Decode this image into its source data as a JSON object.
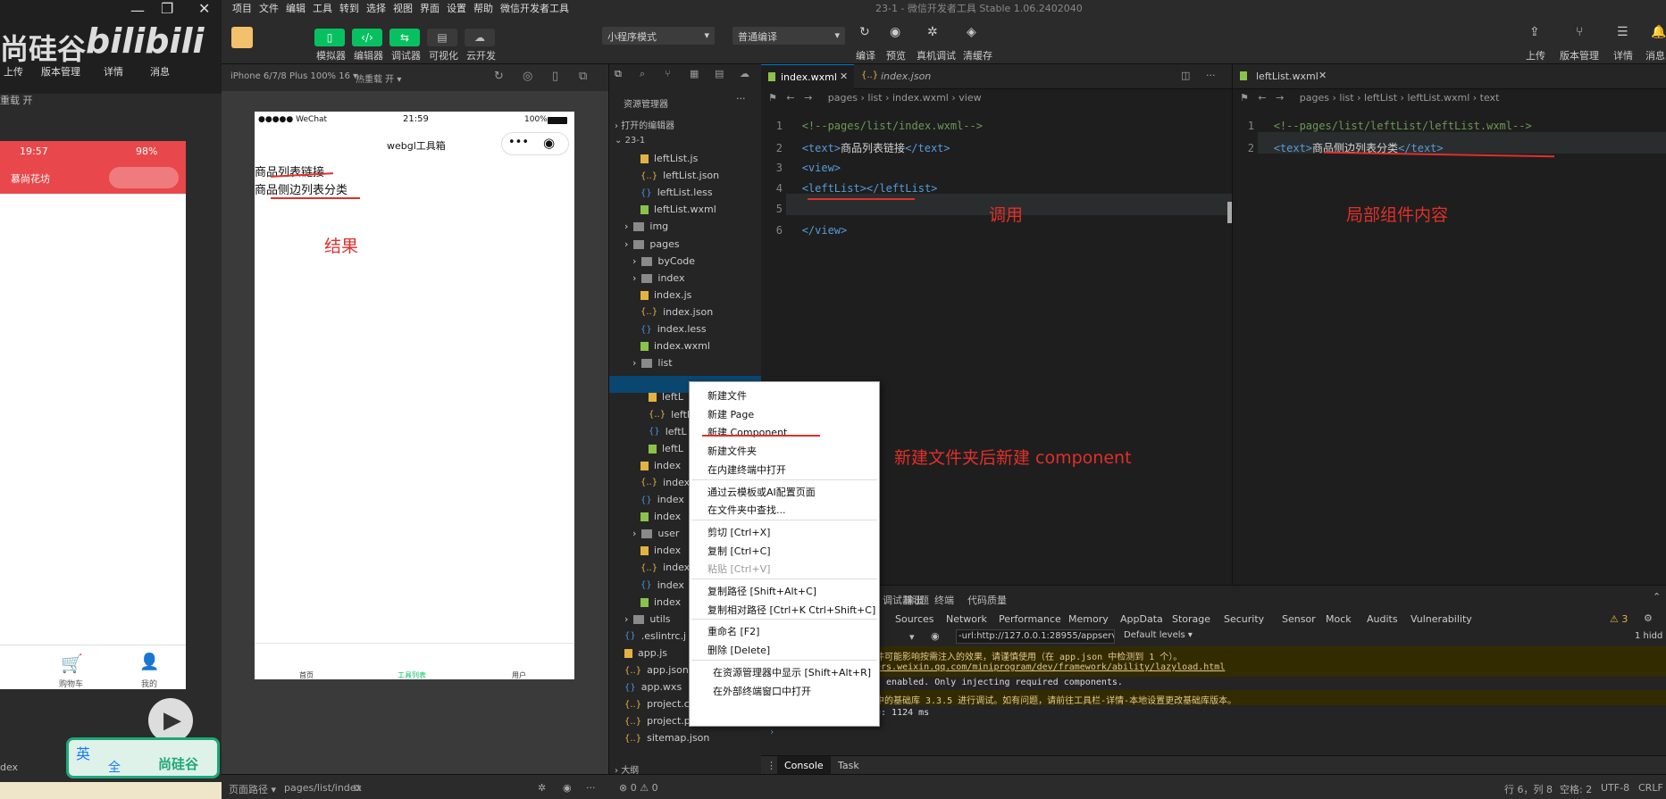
{
  "window_title": "23-1 - 微信开发者工具 Stable 1.06.2402040",
  "menu": [
    "项目",
    "文件",
    "编辑",
    "工具",
    "转到",
    "选择",
    "视图",
    "界面",
    "设置",
    "帮助",
    "微信开发者工具"
  ],
  "toolbar": {
    "buttons": [
      "模拟器",
      "编辑器",
      "调试器",
      "可视化",
      "云开发"
    ],
    "mode_select": "小程序模式",
    "compile_select": "普通编译",
    "actions": [
      "编译",
      "预览",
      "真机调试",
      "清缓存"
    ],
    "right_actions": [
      "上传",
      "版本管理",
      "详情",
      "消息"
    ]
  },
  "simulator": {
    "device": "iPhone 6/7/8 Plus 100% 16",
    "hotreload": "热重载 开",
    "status_carrier": "●●●●● WeChat",
    "status_time": "21:59",
    "status_battery": "100%",
    "nav_title": "webgl工具箱",
    "content_lines": [
      "商品列表链接",
      "商品侧边列表分类"
    ],
    "tabbar": [
      "首页",
      "工具列表",
      "用户"
    ]
  },
  "left_overlay": {
    "brand_text": "尚硅谷",
    "bili_text": "bilibili",
    "menu": [
      "上传",
      "版本管理",
      "详情",
      "消息"
    ],
    "hot": "重载 开",
    "time": "19:57",
    "battery": "98%",
    "shop_title": "慕尚花坊",
    "tabs": [
      "购物车",
      "我的"
    ],
    "ime": "英",
    "ime2": "全",
    "brand_bottom": "尚硅谷",
    "index_label": "dex"
  },
  "explorer": {
    "title": "资源管理器",
    "open_editors": "打开的编辑器",
    "project": "23-1",
    "outline": "大纲",
    "rows": [
      {
        "label": "leftList.js",
        "type": "js",
        "indent": 3
      },
      {
        "label": "leftList.json",
        "type": "json",
        "indent": 3
      },
      {
        "label": "leftList.less",
        "type": "less",
        "indent": 3
      },
      {
        "label": "leftList.wxml",
        "type": "wxml",
        "indent": 3
      },
      {
        "label": "img",
        "type": "folder",
        "indent": 1
      },
      {
        "label": "pages",
        "type": "folder",
        "indent": 1
      },
      {
        "label": "byCode",
        "type": "folder",
        "indent": 2
      },
      {
        "label": "index",
        "type": "folder",
        "indent": 2
      },
      {
        "label": "index.js",
        "type": "js",
        "indent": 3
      },
      {
        "label": "index.json",
        "type": "json",
        "indent": 3
      },
      {
        "label": "index.less",
        "type": "less",
        "indent": 3
      },
      {
        "label": "index.wxml",
        "type": "wxml",
        "indent": 3
      },
      {
        "label": "list",
        "type": "folder",
        "indent": 2
      },
      {
        "label": "leftList",
        "type": "folder",
        "indent": 3
      },
      {
        "label": "leftL",
        "type": "js",
        "indent": 4
      },
      {
        "label": "leftL",
        "type": "json",
        "indent": 4
      },
      {
        "label": "leftL",
        "type": "less",
        "indent": 4
      },
      {
        "label": "leftL",
        "type": "wxml",
        "indent": 4
      },
      {
        "label": "index",
        "type": "js",
        "indent": 3
      },
      {
        "label": "index",
        "type": "json",
        "indent": 3
      },
      {
        "label": "index",
        "type": "less",
        "indent": 3
      },
      {
        "label": "index",
        "type": "wxml",
        "indent": 3
      },
      {
        "label": "user",
        "type": "folder",
        "indent": 2
      },
      {
        "label": "index",
        "type": "js",
        "indent": 3
      },
      {
        "label": "index",
        "type": "json",
        "indent": 3
      },
      {
        "label": "index",
        "type": "less",
        "indent": 3
      },
      {
        "label": "index",
        "type": "wxml",
        "indent": 3
      },
      {
        "label": "utils",
        "type": "folder",
        "indent": 1
      },
      {
        "label": ".eslintrc.j",
        "type": "less",
        "indent": 1
      },
      {
        "label": "app.js",
        "type": "js",
        "indent": 1
      },
      {
        "label": "app.json",
        "type": "json",
        "indent": 1
      },
      {
        "label": "app.wxs",
        "type": "less",
        "indent": 1
      },
      {
        "label": "project.c",
        "type": "json",
        "indent": 1
      },
      {
        "label": "project.p",
        "type": "json",
        "indent": 1
      },
      {
        "label": "sitemap.json",
        "type": "json",
        "indent": 1
      }
    ]
  },
  "editor1": {
    "tabs": [
      "index.wxml",
      "index.json"
    ],
    "breadcrumb": [
      "pages",
      "list",
      "index.wxml",
      "view"
    ],
    "lines": [
      {
        "n": "1",
        "parts": [
          {
            "c": "cm",
            "t": "<!--pages/list/index.wxml-->"
          }
        ]
      },
      {
        "n": "2",
        "parts": [
          {
            "c": "tg",
            "t": "<text>"
          },
          {
            "c": "tx",
            "t": "商品列表链接"
          },
          {
            "c": "tg",
            "t": "</text>"
          }
        ]
      },
      {
        "n": "3",
        "parts": [
          {
            "c": "tg",
            "t": "<view>"
          }
        ]
      },
      {
        "n": "4",
        "parts": [
          {
            "c": "tg",
            "t": "<leftList></leftList>"
          }
        ]
      },
      {
        "n": "5",
        "parts": []
      },
      {
        "n": "6",
        "parts": [
          {
            "c": "tg",
            "t": "</view>"
          }
        ]
      }
    ]
  },
  "editor2": {
    "tabs": [
      "leftList.wxml"
    ],
    "breadcrumb": [
      "pages",
      "list",
      "leftList",
      "leftList.wxml",
      "text"
    ],
    "lines": [
      {
        "n": "1",
        "parts": [
          {
            "c": "cm",
            "t": "<!--pages/list/leftList/leftList.wxml-->"
          }
        ]
      },
      {
        "n": "2",
        "parts": [
          {
            "c": "tg",
            "t": "<text>"
          },
          {
            "c": "tx",
            "t": "商品侧边列表分类"
          },
          {
            "c": "tg",
            "t": "</text>"
          }
        ]
      }
    ]
  },
  "annotations": {
    "result": "结果",
    "call": "调用",
    "local": "局部组件内容",
    "newcomp": "新建文件夹后新建 component"
  },
  "context_menu": {
    "items": [
      {
        "label": "新建文件"
      },
      {
        "label": "新建 Page"
      },
      {
        "label": "新建 Component"
      },
      {
        "label": "新建文件夹"
      },
      {
        "label": "在内建终端中打开",
        "sep": true
      },
      {
        "label": "通过云模板或AI配置页面"
      },
      {
        "label": "在文件夹中查找...",
        "sep": true
      },
      {
        "label": "剪切  [Ctrl+X]"
      },
      {
        "label": "复制  [Ctrl+C]"
      },
      {
        "label": "粘贴  [Ctrl+V]",
        "disabled": true,
        "sep": true
      },
      {
        "label": "复制路径  [Shift+Alt+C]"
      },
      {
        "label": "复制相对路径  [Ctrl+K Ctrl+Shift+C]",
        "sep": true
      },
      {
        "label": "重命名  [F2]"
      },
      {
        "label": "删除  [Delete]",
        "sep": true
      },
      {
        "label": "在资源管理器中显示  [Shift+Alt+R]"
      },
      {
        "label": "在外部终端窗口中打开"
      }
    ]
  },
  "devtools": {
    "top_tabs": [
      "调试器",
      "问题",
      "输出",
      "终端",
      "代码质量"
    ],
    "panels": [
      "Sources",
      "Network",
      "Performance",
      "Memory",
      "AppData",
      "Storage",
      "Security",
      "Sensor",
      "Mock",
      "Audits",
      "Vulnerability"
    ],
    "warnings": "3",
    "filter": "-url:http://127.0.0.1:28955/appservice/__de",
    "levels": "Default levels",
    "hidden": "1 hidd",
    "console_lines": [
      {
        "text": "件可能影响按需注入的效果，请谨慎使用（在 app.json 中检测到 1 个）。",
        "warn": true
      },
      {
        "text": "ers.weixin.qq.com/miniprogram/dev/framework/ability/lazyload.html",
        "warn": true,
        "link": true
      },
      {
        "text": "s enabled. Only injecting required components.",
        "warn": false
      },
      {
        "text": "中的基础库 3.3.5 进行调试。如有问题，请前往工具栏-详情-本地设置更改基础库版本。",
        "warn": true
      },
      {
        "text": "e: 1124 ms",
        "warn": false
      }
    ],
    "bottom_tabs": [
      "Console",
      "Task"
    ]
  },
  "statusbar": {
    "page_path_label": "页面路径",
    "page_path": "pages/list/index",
    "errors": "⊗ 0 ⚠ 0",
    "position": "行 6，列 8",
    "spaces": "空格: 2",
    "encoding": "UTF-8",
    "eol": "CRLF"
  }
}
